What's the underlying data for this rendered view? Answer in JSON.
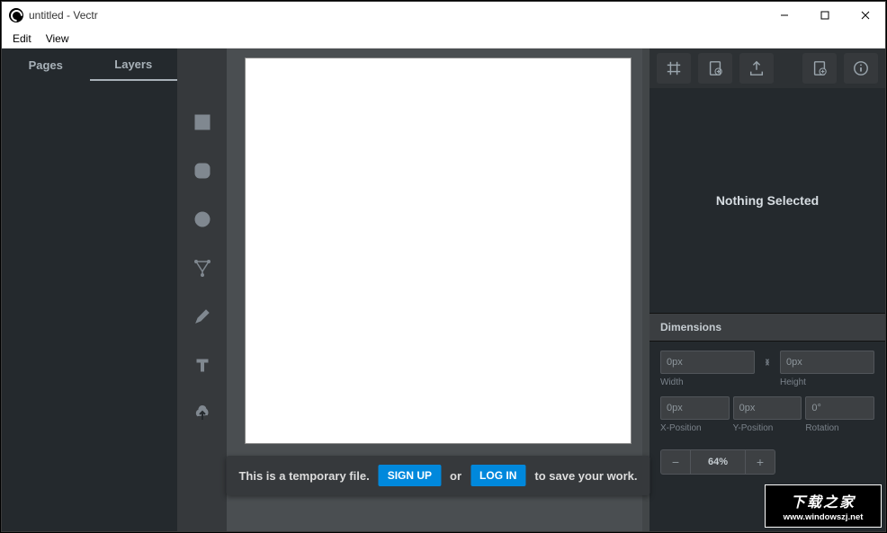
{
  "window": {
    "title": "untitled - Vectr"
  },
  "menu": {
    "edit": "Edit",
    "view": "View"
  },
  "left_tabs": {
    "pages": "Pages",
    "layers": "Layers"
  },
  "notice": {
    "pre": "This is a temporary file.",
    "signup": "SIGN UP",
    "or": "or",
    "login": "LOG IN",
    "post": "to save your work."
  },
  "right": {
    "nothing": "Nothing Selected",
    "dimensions": "Dimensions",
    "width_val": "0px",
    "width_label": "Width",
    "height_val": "0px",
    "height_label": "Height",
    "xpos_val": "0px",
    "xpos_label": "X-Position",
    "ypos_val": "0px",
    "ypos_label": "Y-Position",
    "rot_val": "0°",
    "rot_label": "Rotation",
    "zoom": "64%"
  },
  "watermark": {
    "ch": "下载之家",
    "en": "www.windowszj.net"
  }
}
